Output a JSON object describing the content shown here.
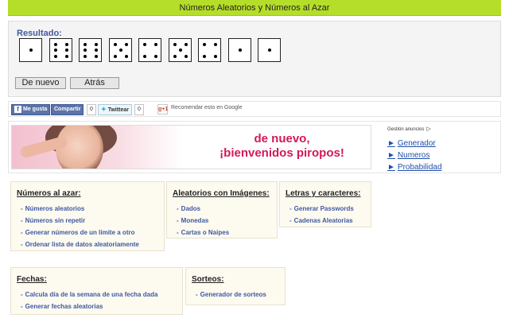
{
  "header": {
    "title": "Números Aleatorios y Números al Azar"
  },
  "result": {
    "label": "Resultado:",
    "dice": [
      1,
      6,
      6,
      5,
      4,
      5,
      4,
      1,
      1
    ],
    "buttons": {
      "again": "De nuevo",
      "back": "Atrás"
    }
  },
  "social": {
    "facebook_like": "Me gusta",
    "facebook_share": "Compartir",
    "share_count": "0",
    "twitter": "Twittear",
    "tweet_count": "0",
    "gplus": "g+1",
    "gplus_text": "Recomendar esto en Google"
  },
  "ad": {
    "banner_text_line1": "de nuevo,",
    "banner_text_line2": "¡bienvenidos piropos!",
    "info": "Gestión anuncios",
    "links": [
      "Generador",
      "Numeros",
      "Probabilidad"
    ],
    "link_arrow": "►"
  },
  "sections": {
    "numeros": {
      "title": "Números al azar:",
      "items": [
        "Números aleatorios",
        "Números sin repetir",
        "Generar números de un límite a otro",
        "Ordenar lista de datos aleatoriamente"
      ]
    },
    "imagenes": {
      "title": "Aleatorios con Imágenes:",
      "items": [
        "Dados",
        "Monedas",
        "Cartas o Naipes"
      ]
    },
    "letras": {
      "title": "Letras y caracteres:",
      "items": [
        "Generar Passwords",
        "Cadenas Aleatorias"
      ]
    },
    "fechas": {
      "title": "Fechas:",
      "items": [
        "Calcula día de la semana de una fecha dada",
        "Generar fechas aleatorias"
      ]
    },
    "sorteos": {
      "title": "Sorteos:",
      "items": [
        "Generador de sorteos"
      ]
    }
  },
  "list_dash": "-",
  "colors": {
    "header_bg": "#b5de2a",
    "link": "#3f5aa0",
    "banner_text": "#d3185b"
  }
}
